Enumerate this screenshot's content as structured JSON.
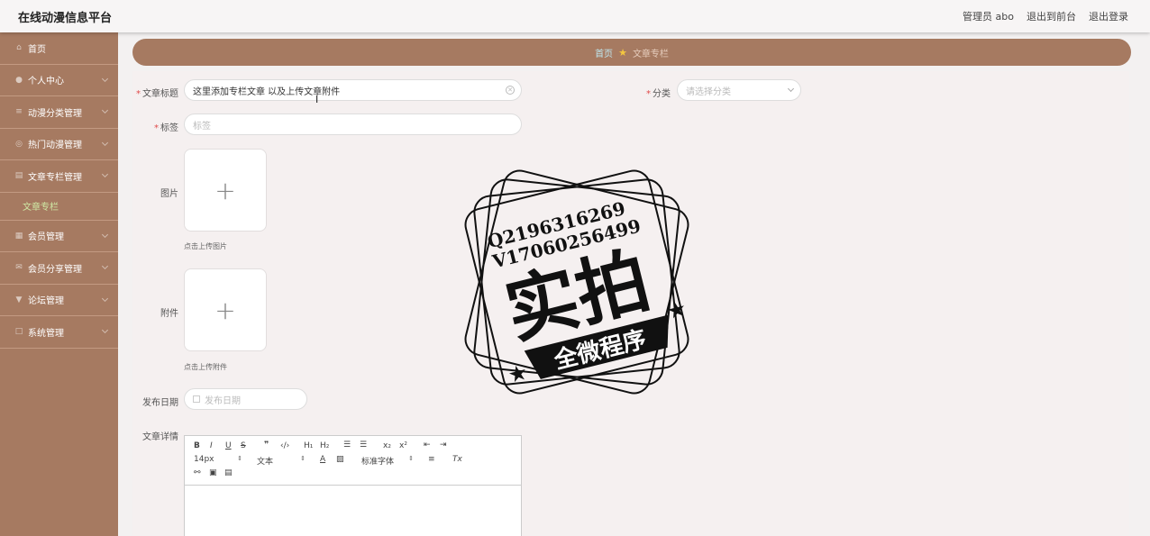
{
  "header": {
    "title": "在线动漫信息平台",
    "links": [
      "管理员 abo",
      "退出到前台",
      "退出登录"
    ]
  },
  "sidebar": {
    "items": [
      {
        "label": "首页",
        "icon": "home-icon",
        "chevron": false
      },
      {
        "label": "个人中心",
        "icon": "user-icon",
        "chevron": true
      },
      {
        "label": "动漫分类管理",
        "icon": "list-icon",
        "chevron": true
      },
      {
        "label": "热门动漫管理",
        "icon": "globe-icon",
        "chevron": true
      },
      {
        "label": "文章专栏管理",
        "icon": "document-icon",
        "chevron": true
      },
      {
        "label": "会员管理",
        "icon": "clipboard-icon",
        "chevron": true
      },
      {
        "label": "会员分享管理",
        "icon": "mail-icon",
        "chevron": true
      },
      {
        "label": "论坛管理",
        "icon": "pin-icon",
        "chevron": true
      },
      {
        "label": "系统管理",
        "icon": "settings-icon",
        "chevron": true
      }
    ],
    "active_sub": "文章专栏"
  },
  "breadcrumb": {
    "home": "首页",
    "current": "文章专栏"
  },
  "form": {
    "title_label": "文章标题",
    "title_value": "这里添加专栏文章 以及上传文章附件",
    "category_label": "分类",
    "category_placeholder": "请选择分类",
    "tag_label": "标签",
    "tag_placeholder": "标签",
    "image_label": "图片",
    "image_hint": "点击上传图片",
    "attach_label": "附件",
    "attach_hint": "点击上传附件",
    "date_label": "发布日期",
    "date_placeholder": "发布日期",
    "detail_label": "文章详情"
  },
  "editor_toolbar": {
    "font_size": "14px",
    "header_select": "文本",
    "font_family": "标准字体"
  },
  "watermark": {
    "line1": "Q2196316269",
    "line2": "V17060256499",
    "main": "实拍",
    "banner": "全微程序"
  },
  "colors": {
    "accent": "#a67a61",
    "active_sub": "#cfe9a5",
    "crumb_home": "#bfe7ef"
  }
}
